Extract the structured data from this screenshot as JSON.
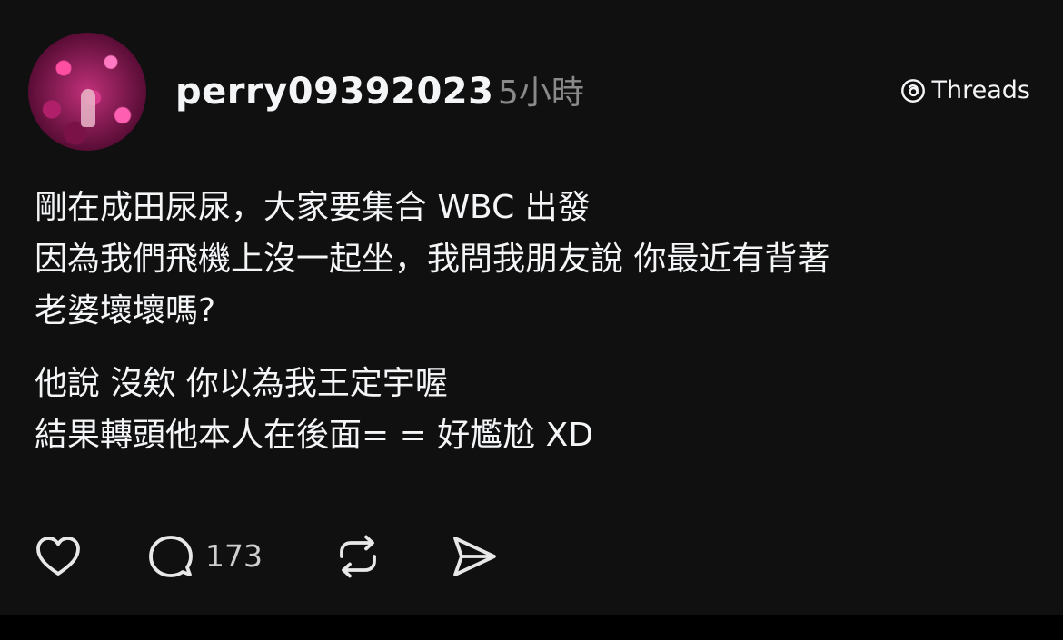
{
  "post": {
    "username": "perry09392023",
    "timestamp": "5小時",
    "brand": "Threads",
    "lines": [
      "剛在成田尿尿，大家要集合 WBC 出發",
      "因為我們飛機上沒一起坐，我問我朋友說 你最近有背著",
      "老婆壞壞嗎?"
    ],
    "lines2": [
      "他說 沒欸 你以為我王定宇喔",
      "結果轉頭他本人在後面= = 好尷尬 XD"
    ],
    "actions": {
      "like_icon": "heart-icon",
      "reply_icon": "comment-icon",
      "reply_count": "173",
      "repost_icon": "repost-icon",
      "share_icon": "send-icon"
    }
  },
  "colors": {
    "background": "#101010",
    "text": "#f3f5f7",
    "muted": "#8a8a8a"
  }
}
